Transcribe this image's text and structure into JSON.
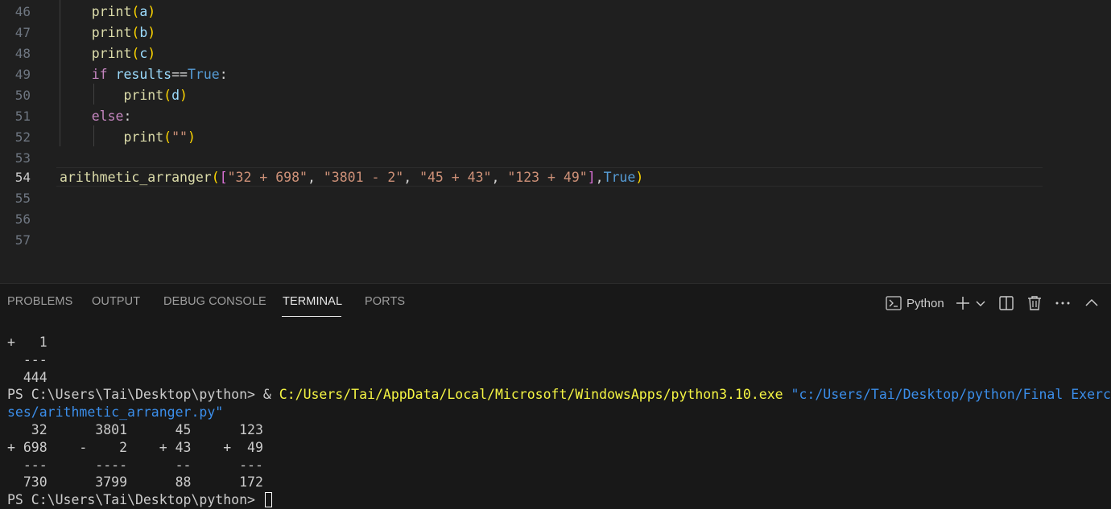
{
  "editor": {
    "active_line": "54",
    "lines": [
      {
        "n": "46",
        "t": "    print(a)"
      },
      {
        "n": "47",
        "t": "    print(b)"
      },
      {
        "n": "48",
        "t": "    print(c)"
      },
      {
        "n": "49",
        "t": "    if results==True:"
      },
      {
        "n": "50",
        "t": "        print(d)"
      },
      {
        "n": "51",
        "t": "    else:"
      },
      {
        "n": "52",
        "t": "        print(\"\")"
      },
      {
        "n": "53",
        "t": ""
      },
      {
        "n": "54",
        "t": "arithmetic_arranger([\"32 + 698\", \"3801 - 2\", \"45 + 43\", \"123 + 49\"],True)"
      },
      {
        "n": "55",
        "t": ""
      },
      {
        "n": "56",
        "t": ""
      },
      {
        "n": "57",
        "t": ""
      }
    ]
  },
  "panel": {
    "tabs": [
      "PROBLEMS",
      "OUTPUT",
      "DEBUG CONSOLE",
      "TERMINAL",
      "PORTS"
    ],
    "active_tab": "TERMINAL",
    "terminal_name": "Python",
    "icons": [
      "terminal-icon",
      "plus-icon",
      "chevron-down-icon",
      "split-icon",
      "trash-icon",
      "more-icon",
      "chevron-up-icon"
    ]
  },
  "terminal": {
    "lines": [
      "+   1",
      "  ---",
      "  444",
      "PS C:\\Users\\Tai\\Desktop\\python> & C:/Users/Tai/AppData/Local/Microsoft/WindowsApps/python3.10.exe \"c:/Users/Tai/Desktop/python/Final Exerc",
      "ses/arithmetic_arranger.py\"",
      "   32      3801      45      123",
      "+ 698    -    2    + 43    +  49",
      "  ---      ----      --      ---",
      "  730      3799      88      172",
      "PS C:\\Users\\Tai\\Desktop\\python> "
    ],
    "prompt": "PS C:\\Users\\Tai\\Desktop\\python> ",
    "command_amp": "& ",
    "command_exe": "C:/Users/Tai/AppData/Local/Microsoft/WindowsApps/python3.10.exe",
    "command_arg_part1": "\"c:/Users/Tai/Desktop/python/Final Exerc",
    "command_arg_part2": "ses/arithmetic_arranger.py\""
  },
  "colors": {
    "background": "#1f1f1f",
    "panel_background": "#181818",
    "function": "#dcdcaa",
    "keyword": "#c586c0",
    "builtin_constant": "#569cd6",
    "string": "#ce9178",
    "variable": "#9cdcfe",
    "terminal_exe": "#f5f543",
    "terminal_arg": "#3b8eea"
  }
}
